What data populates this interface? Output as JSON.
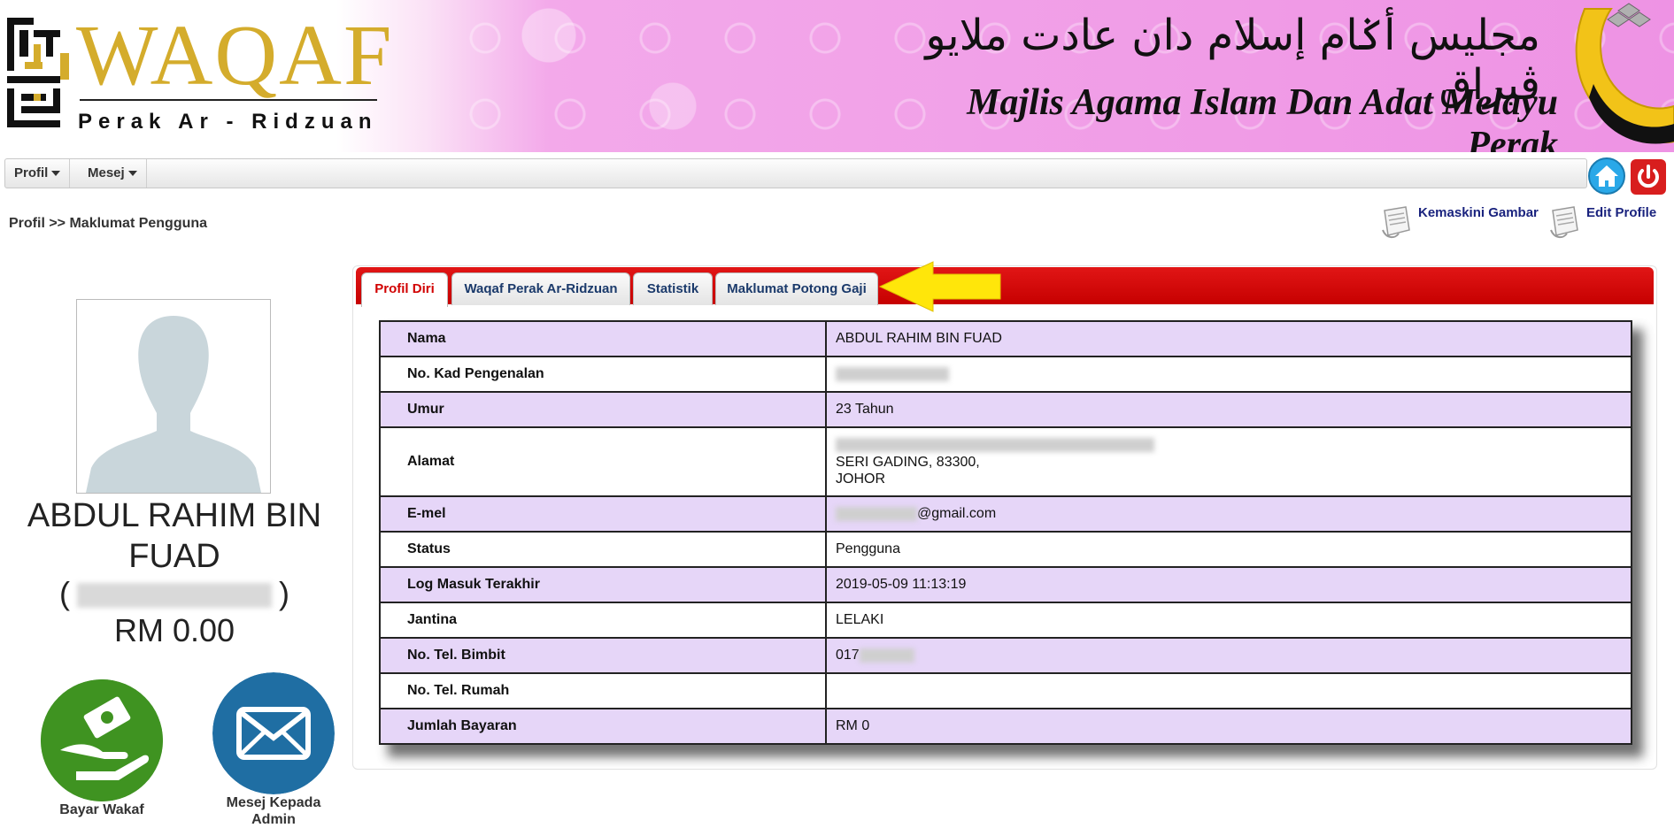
{
  "header": {
    "logo_text": "WAQAF",
    "logo_sub": "Perak Ar - Ridzuan",
    "jawi_text": "مجليس أݢام إسلام دان عادت ملايو ڤيراق",
    "org_name": "Majlis Agama Islam Dan Adat Melayu Perak"
  },
  "menu": {
    "items": [
      {
        "label": "Profil"
      },
      {
        "label": "Mesej"
      }
    ],
    "home_icon": "home-icon",
    "power_icon": "power-icon"
  },
  "breadcrumb": "Profil >> Maklumat Pengguna",
  "actions": {
    "update_photo": "Kemaskini Gambar",
    "edit_profile": "Edit Profile"
  },
  "profile": {
    "name": "ABDUL RAHIM BIN FUAD",
    "id_open": "(",
    "id_close": ")",
    "balance": "RM 0.00"
  },
  "buttons": {
    "pay": "Bayar Wakaf",
    "message_admin": "Mesej Kepada Admin"
  },
  "tabs": [
    {
      "label": "Profil Diri",
      "active": true
    },
    {
      "label": "Waqaf Perak Ar-Ridzuan",
      "active": false
    },
    {
      "label": "Statistik",
      "active": false
    },
    {
      "label": "Maklumat Potong Gaji",
      "active": false
    }
  ],
  "details": {
    "rows": [
      {
        "label": "Nama",
        "value": "ABDUL RAHIM BIN FUAD"
      },
      {
        "label": "No. Kad Pengenalan",
        "value": ""
      },
      {
        "label": "Umur",
        "value": "23 Tahun"
      },
      {
        "label": "Alamat",
        "value_line2": "SERI GADING, 83300,",
        "value_line3": "JOHOR"
      },
      {
        "label": "E-mel",
        "value_suffix": "@gmail.com"
      },
      {
        "label": "Status",
        "value": "Pengguna"
      },
      {
        "label": "Log Masuk Terakhir",
        "value": "2019-05-09 11:13:19"
      },
      {
        "label": "Jantina",
        "value": "LELAKI"
      },
      {
        "label": "No. Tel. Bimbit",
        "value_prefix": "017"
      },
      {
        "label": "No. Tel. Rumah",
        "value": ""
      },
      {
        "label": "Jumlah Bayaran",
        "value": "RM 0"
      }
    ]
  },
  "colors": {
    "tab_bar": "#d10000",
    "row_highlight": "#e6d6f8",
    "link": "#1a237e",
    "logo_gold": "#d4ac2c"
  }
}
